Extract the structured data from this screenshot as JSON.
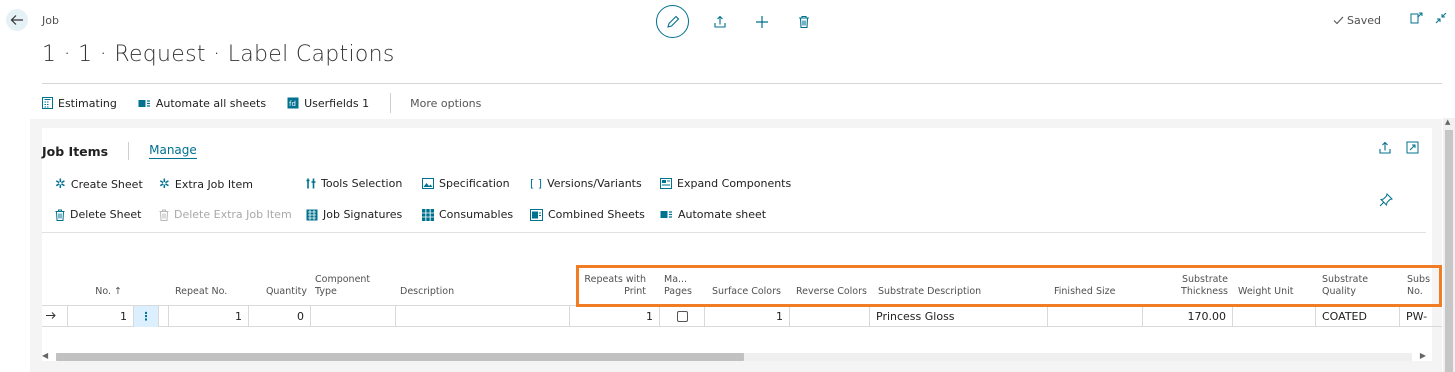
{
  "header": {
    "page_type": "Job",
    "title": "1 · 1 · Request · Label Captions",
    "saved_label": "Saved"
  },
  "action_bar": {
    "items": [
      {
        "label": "Estimating",
        "icon": "calculator-icon"
      },
      {
        "label": "Automate all sheets",
        "icon": "automate-icon"
      },
      {
        "label": "Userfields 1",
        "icon": "userfields-icon"
      }
    ],
    "more_options": "More options"
  },
  "part": {
    "title": "Job Items",
    "tab": "Manage",
    "actions_row1": [
      {
        "label": "Create Sheet",
        "icon": "sparkle-icon"
      },
      {
        "label": "Extra Job Item",
        "icon": "sparkle-icon"
      },
      {
        "label": "Tools Selection",
        "icon": "tools-icon"
      },
      {
        "label": "Specification",
        "icon": "image-icon"
      },
      {
        "label": "Versions/Variants",
        "icon": "brackets-icon"
      },
      {
        "label": "Expand Components",
        "icon": "expand-icon"
      }
    ],
    "actions_row2": [
      {
        "label": "Delete Sheet",
        "icon": "trash-icon"
      },
      {
        "label": "Delete Extra Job Item",
        "icon": "trash-icon"
      },
      {
        "label": "Job Signatures",
        "icon": "signatures-icon"
      },
      {
        "label": "Consumables",
        "icon": "grid-icon"
      },
      {
        "label": "Combined Sheets",
        "icon": "combined-icon"
      },
      {
        "label": "Automate sheet",
        "icon": "automate-icon"
      }
    ]
  },
  "grid": {
    "columns": {
      "no": "No. ↑",
      "repeat_no": "Repeat No.",
      "quantity": "Quantity",
      "component_type_1": "Component",
      "component_type_2": "Type",
      "description": "Description",
      "repeats_print_1": "Repeats with",
      "repeats_print_2": "Print",
      "ma_pages_1": "Ma...",
      "ma_pages_2": "Pages",
      "surface_colors": "Surface Colors",
      "reverse_colors": "Reverse Colors",
      "substrate_description": "Substrate Description",
      "finished_size": "Finished Size",
      "substrate_thickness_1": "Substrate",
      "substrate_thickness_2": "Thickness",
      "weight_unit": "Weight Unit",
      "substrate_quality_1": "Substrate",
      "substrate_quality_2": "Quality",
      "subs_no_1": "Subs",
      "subs_no_2": "No."
    },
    "row": {
      "no": "1",
      "repeat_no": "1",
      "quantity": "0",
      "component_type": "",
      "description": "",
      "repeats_with_print": "1",
      "ma_pages_checked": false,
      "surface_colors": "1",
      "reverse_colors": "",
      "substrate_description": "Princess Gloss",
      "finished_size": "",
      "substrate_thickness": "170.00",
      "weight_unit": "",
      "substrate_quality": "COATED",
      "subs_no": "PW-"
    }
  },
  "colors": {
    "accent": "#00718f",
    "highlight": "#f07d23"
  }
}
